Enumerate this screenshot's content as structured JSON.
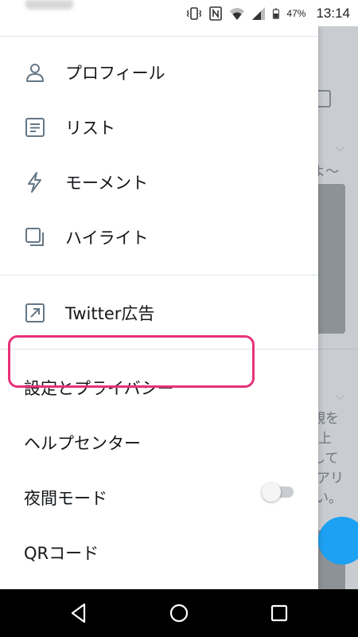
{
  "status_bar": {
    "battery": "47%",
    "time": "13:14",
    "icons": [
      "vibrate-icon",
      "nfc-icon",
      "wifi-icon",
      "signal-icon",
      "battery-icon"
    ]
  },
  "menu": {
    "items": [
      {
        "label": "プロフィール",
        "icon": "person-icon"
      },
      {
        "label": "リスト",
        "icon": "list-icon"
      },
      {
        "label": "モーメント",
        "icon": "lightning-icon"
      },
      {
        "label": "ハイライト",
        "icon": "highlights-icon"
      }
    ],
    "ads": {
      "label": "Twitter広告",
      "icon": "external-link-icon"
    },
    "settings_label": "設定とプライバシー",
    "help_label": "ヘルプセンター",
    "night_mode": {
      "label": "夜間モード",
      "enabled": false
    },
    "qr_label": "QRコード"
  },
  "background_timeline": {
    "fragments": [
      "よ～",
      "覗を",
      "上",
      "して",
      "アリ",
      "い。"
    ]
  },
  "nav_bar": {
    "buttons": [
      "back-icon",
      "home-icon",
      "recents-icon"
    ]
  },
  "colors": {
    "highlight": "#e8317a",
    "accent": "#1da1f2",
    "icon": "#657786",
    "text": "#14171a"
  }
}
